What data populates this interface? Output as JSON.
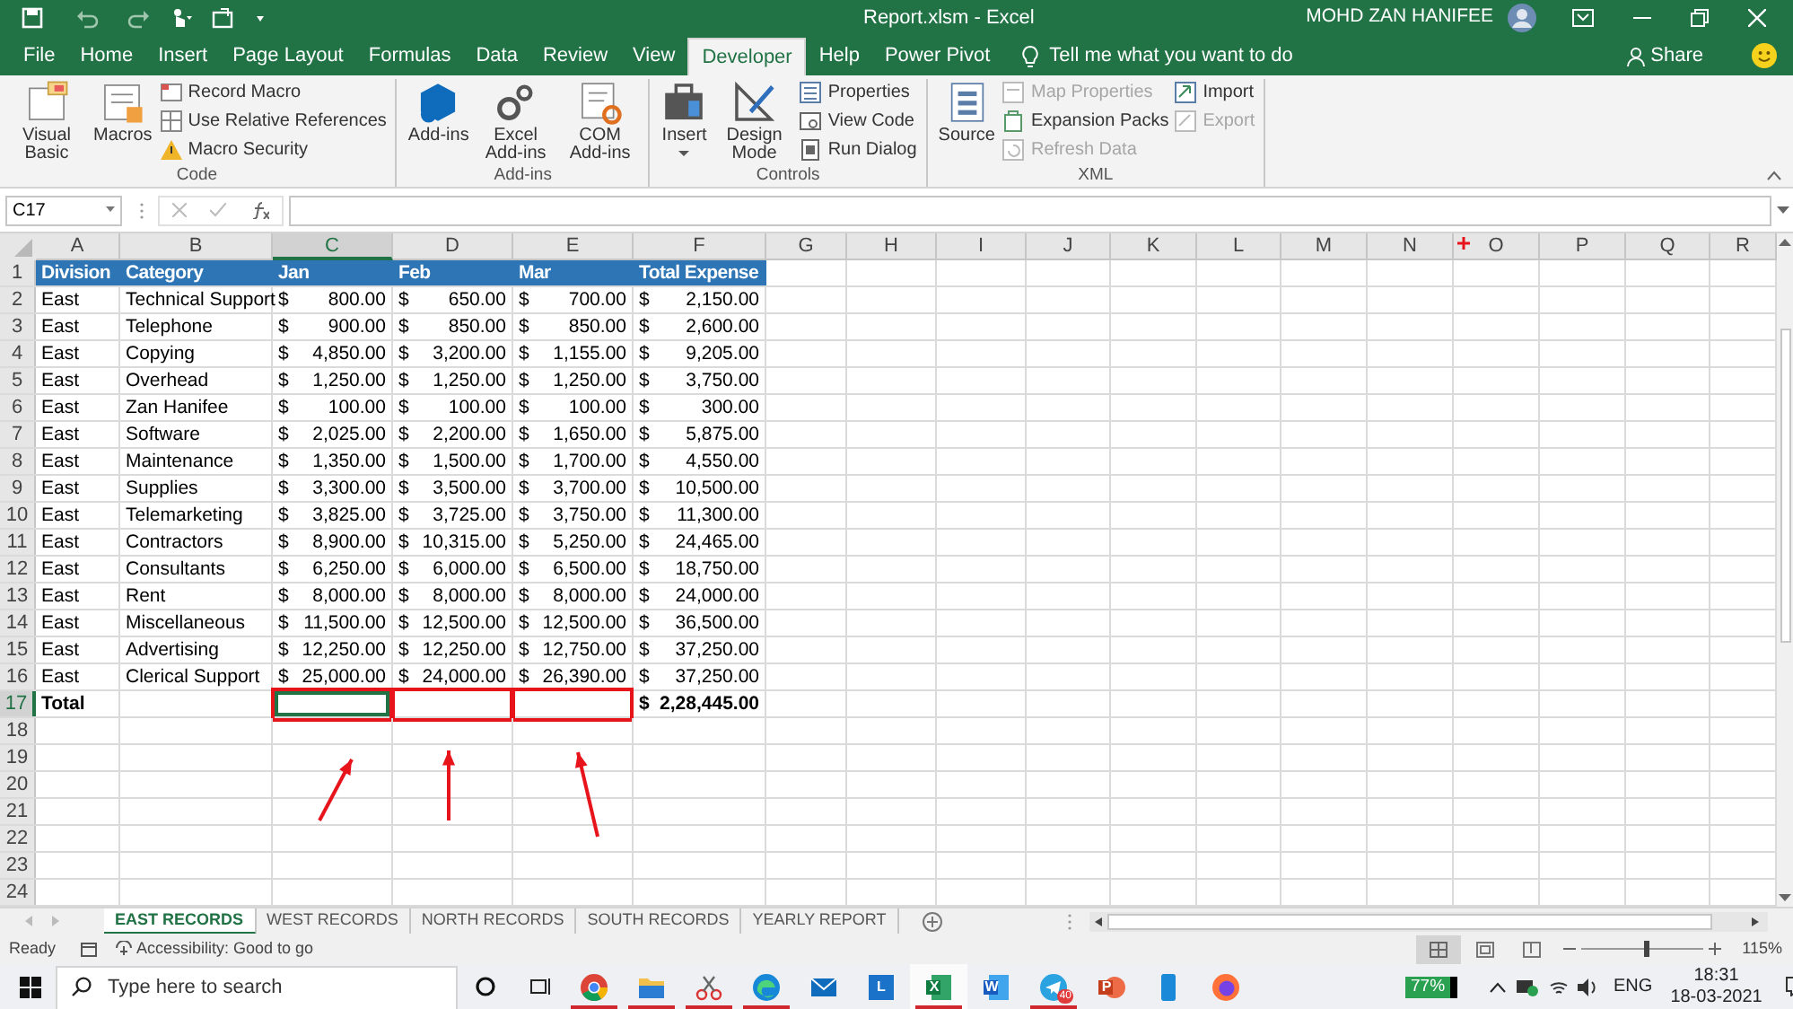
{
  "title_bar": {
    "file_title": "Report.xlsm  -  Excel",
    "user_name": "MOHD ZAN HANIFEE"
  },
  "ribbon_tabs": [
    {
      "label": "File",
      "selected": false
    },
    {
      "label": "Home",
      "selected": false
    },
    {
      "label": "Insert",
      "selected": false
    },
    {
      "label": "Page Layout",
      "selected": false
    },
    {
      "label": "Formulas",
      "selected": false
    },
    {
      "label": "Data",
      "selected": false
    },
    {
      "label": "Review",
      "selected": false
    },
    {
      "label": "View",
      "selected": false
    },
    {
      "label": "Developer",
      "selected": true
    },
    {
      "label": "Help",
      "selected": false
    },
    {
      "label": "Power Pivot",
      "selected": false
    }
  ],
  "tell_me": "Tell me what you want to do",
  "share": "Share",
  "ribbon_groups": [
    {
      "label": "Code",
      "items": [
        {
          "kind": "large",
          "label": "Visual Basic"
        },
        {
          "kind": "large",
          "label": "Macros"
        },
        {
          "kind": "small_column",
          "buttons": [
            {
              "label": "Record Macro",
              "disabled": false
            },
            {
              "label": "Use Relative References",
              "disabled": false
            },
            {
              "label": "Macro Security",
              "disabled": false
            }
          ]
        }
      ]
    },
    {
      "label": "Add-ins",
      "items": [
        {
          "kind": "large",
          "label": "Add-ins"
        },
        {
          "kind": "large",
          "label": "Excel Add-ins"
        },
        {
          "kind": "large",
          "label": "COM Add-ins"
        }
      ]
    },
    {
      "label": "Controls",
      "items": [
        {
          "kind": "large",
          "label": "Insert",
          "dropdown": true
        },
        {
          "kind": "large",
          "label": "Design Mode"
        },
        {
          "kind": "small_column",
          "buttons": [
            {
              "label": "Properties",
              "disabled": false
            },
            {
              "label": "View Code",
              "disabled": false
            },
            {
              "label": "Run Dialog",
              "disabled": false
            }
          ]
        }
      ]
    },
    {
      "label": "XML",
      "items": [
        {
          "kind": "large",
          "label": "Source"
        },
        {
          "kind": "small_column",
          "buttons": [
            {
              "label": "Map Properties",
              "disabled": true
            },
            {
              "label": "Expansion Packs",
              "disabled": false
            },
            {
              "label": "Refresh Data",
              "disabled": true
            }
          ]
        },
        {
          "kind": "small_column",
          "buttons": [
            {
              "label": "Import",
              "disabled": false
            },
            {
              "label": "Export",
              "disabled": true
            }
          ]
        }
      ]
    }
  ],
  "formula_bar": {
    "name_box": "C17"
  },
  "columns": [
    {
      "label": "A",
      "selected": false
    },
    {
      "label": "B",
      "selected": false
    },
    {
      "label": "C",
      "selected": true
    },
    {
      "label": "D",
      "selected": false
    },
    {
      "label": "E",
      "selected": false
    },
    {
      "label": "F",
      "selected": false
    },
    {
      "label": "G",
      "selected": false
    },
    {
      "label": "H",
      "selected": false
    },
    {
      "label": "I",
      "selected": false
    },
    {
      "label": "J",
      "selected": false
    },
    {
      "label": "K",
      "selected": false
    },
    {
      "label": "L",
      "selected": false
    },
    {
      "label": "M",
      "selected": false
    },
    {
      "label": "N",
      "selected": false
    },
    {
      "label": "O",
      "selected": false
    },
    {
      "label": "P",
      "selected": false
    },
    {
      "label": "Q",
      "selected": false
    },
    {
      "label": "R",
      "selected": false
    }
  ],
  "rows": [
    {
      "number": "1",
      "kind": "header",
      "selected": false,
      "cells": [
        "Division",
        "Category",
        "Jan",
        "Feb",
        "Mar",
        "Total Expense"
      ]
    },
    {
      "number": "2",
      "kind": "data",
      "selected": false,
      "cells": [
        "East",
        "Technical Support",
        {
          "currency": "$",
          "amount": "800.00"
        },
        {
          "currency": "$",
          "amount": "650.00"
        },
        {
          "currency": "$",
          "amount": "700.00"
        },
        {
          "currency": "$",
          "amount": "2,150.00"
        }
      ]
    },
    {
      "number": "3",
      "kind": "data",
      "selected": false,
      "cells": [
        "East",
        "Telephone",
        {
          "currency": "$",
          "amount": "900.00"
        },
        {
          "currency": "$",
          "amount": "850.00"
        },
        {
          "currency": "$",
          "amount": "850.00"
        },
        {
          "currency": "$",
          "amount": "2,600.00"
        }
      ]
    },
    {
      "number": "4",
      "kind": "data",
      "selected": false,
      "cells": [
        "East",
        "Copying",
        {
          "currency": "$",
          "amount": "4,850.00"
        },
        {
          "currency": "$",
          "amount": "3,200.00"
        },
        {
          "currency": "$",
          "amount": "1,155.00"
        },
        {
          "currency": "$",
          "amount": "9,205.00"
        }
      ]
    },
    {
      "number": "5",
      "kind": "data",
      "selected": false,
      "cells": [
        "East",
        "Overhead",
        {
          "currency": "$",
          "amount": "1,250.00"
        },
        {
          "currency": "$",
          "amount": "1,250.00"
        },
        {
          "currency": "$",
          "amount": "1,250.00"
        },
        {
          "currency": "$",
          "amount": "3,750.00"
        }
      ]
    },
    {
      "number": "6",
      "kind": "data",
      "selected": false,
      "cells": [
        "East",
        "Zan Hanifee",
        {
          "currency": "$",
          "amount": "100.00"
        },
        {
          "currency": "$",
          "amount": "100.00"
        },
        {
          "currency": "$",
          "amount": "100.00"
        },
        {
          "currency": "$",
          "amount": "300.00"
        }
      ]
    },
    {
      "number": "7",
      "kind": "data",
      "selected": false,
      "cells": [
        "East",
        "Software",
        {
          "currency": "$",
          "amount": "2,025.00"
        },
        {
          "currency": "$",
          "amount": "2,200.00"
        },
        {
          "currency": "$",
          "amount": "1,650.00"
        },
        {
          "currency": "$",
          "amount": "5,875.00"
        }
      ]
    },
    {
      "number": "8",
      "kind": "data",
      "selected": false,
      "cells": [
        "East",
        "Maintenance",
        {
          "currency": "$",
          "amount": "1,350.00"
        },
        {
          "currency": "$",
          "amount": "1,500.00"
        },
        {
          "currency": "$",
          "amount": "1,700.00"
        },
        {
          "currency": "$",
          "amount": "4,550.00"
        }
      ]
    },
    {
      "number": "9",
      "kind": "data",
      "selected": false,
      "cells": [
        "East",
        "Supplies",
        {
          "currency": "$",
          "amount": "3,300.00"
        },
        {
          "currency": "$",
          "amount": "3,500.00"
        },
        {
          "currency": "$",
          "amount": "3,700.00"
        },
        {
          "currency": "$",
          "amount": "10,500.00"
        }
      ]
    },
    {
      "number": "10",
      "kind": "data",
      "selected": false,
      "cells": [
        "East",
        "Telemarketing",
        {
          "currency": "$",
          "amount": "3,825.00"
        },
        {
          "currency": "$",
          "amount": "3,725.00"
        },
        {
          "currency": "$",
          "amount": "3,750.00"
        },
        {
          "currency": "$",
          "amount": "11,300.00"
        }
      ]
    },
    {
      "number": "11",
      "kind": "data",
      "selected": false,
      "cells": [
        "East",
        "Contractors",
        {
          "currency": "$",
          "amount": "8,900.00"
        },
        {
          "currency": "$",
          "amount": "10,315.00"
        },
        {
          "currency": "$",
          "amount": "5,250.00"
        },
        {
          "currency": "$",
          "amount": "24,465.00"
        }
      ]
    },
    {
      "number": "12",
      "kind": "data",
      "selected": false,
      "cells": [
        "East",
        "Consultants",
        {
          "currency": "$",
          "amount": "6,250.00"
        },
        {
          "currency": "$",
          "amount": "6,000.00"
        },
        {
          "currency": "$",
          "amount": "6,500.00"
        },
        {
          "currency": "$",
          "amount": "18,750.00"
        }
      ]
    },
    {
      "number": "13",
      "kind": "data",
      "selected": false,
      "cells": [
        "East",
        "Rent",
        {
          "currency": "$",
          "amount": "8,000.00"
        },
        {
          "currency": "$",
          "amount": "8,000.00"
        },
        {
          "currency": "$",
          "amount": "8,000.00"
        },
        {
          "currency": "$",
          "amount": "24,000.00"
        }
      ]
    },
    {
      "number": "14",
      "kind": "data",
      "selected": false,
      "cells": [
        "East",
        "Miscellaneous",
        {
          "currency": "$",
          "amount": "11,500.00"
        },
        {
          "currency": "$",
          "amount": "12,500.00"
        },
        {
          "currency": "$",
          "amount": "12,500.00"
        },
        {
          "currency": "$",
          "amount": "36,500.00"
        }
      ]
    },
    {
      "number": "15",
      "kind": "data",
      "selected": false,
      "cells": [
        "East",
        "Advertising",
        {
          "currency": "$",
          "amount": "12,250.00"
        },
        {
          "currency": "$",
          "amount": "12,250.00"
        },
        {
          "currency": "$",
          "amount": "12,750.00"
        },
        {
          "currency": "$",
          "amount": "37,250.00"
        }
      ]
    },
    {
      "number": "16",
      "kind": "data",
      "selected": false,
      "cells": [
        "East",
        "Clerical Support",
        {
          "currency": "$",
          "amount": "25,000.00"
        },
        {
          "currency": "$",
          "amount": "24,000.00"
        },
        {
          "currency": "$",
          "amount": "26,390.00"
        },
        {
          "currency": "$",
          "amount": "37,250.00"
        }
      ]
    },
    {
      "number": "17",
      "kind": "total",
      "selected": true,
      "cells": [
        "Total",
        null,
        {
          "annotated": true
        },
        {
          "annotated": true
        },
        {
          "annotated": true
        },
        {
          "currency": "$",
          "amount": "2,28,445.00"
        }
      ]
    },
    {
      "number": "18",
      "kind": "empty",
      "selected": false
    },
    {
      "number": "19",
      "kind": "empty",
      "selected": false
    },
    {
      "number": "20",
      "kind": "empty",
      "selected": false
    },
    {
      "number": "21",
      "kind": "empty",
      "selected": false
    },
    {
      "number": "22",
      "kind": "empty",
      "selected": false
    },
    {
      "number": "23",
      "kind": "empty",
      "selected": false
    },
    {
      "number": "24",
      "kind": "empty",
      "selected": false
    }
  ],
  "sheet_tabs": [
    {
      "label": "EAST RECORDS",
      "selected": true
    },
    {
      "label": "WEST RECORDS",
      "selected": false
    },
    {
      "label": "NORTH RECORDS",
      "selected": false
    },
    {
      "label": "SOUTH RECORDS",
      "selected": false
    },
    {
      "label": "YEARLY REPORT",
      "selected": false
    }
  ],
  "status_bar": {
    "mode": "Ready",
    "accessibility": "Accessibility: Good to go",
    "zoom_slider": {
      "level": 0.55
    },
    "zoom": "115%"
  },
  "taskbar": {
    "search_placeholder": "Type here to search",
    "apps": [
      {
        "kind": "chrome",
        "running": true,
        "selected": false
      },
      {
        "kind": "folder",
        "running": true,
        "selected": false
      },
      {
        "kind": "scissors",
        "running": true,
        "selected": false
      },
      {
        "kind": "edge",
        "running": true,
        "selected": false
      },
      {
        "kind": "mail",
        "running": false,
        "selected": false
      },
      {
        "kind": "letter",
        "glyph": "L",
        "running": false,
        "selected": false
      },
      {
        "kind": "excel",
        "glyph": "X",
        "running": true,
        "selected": true
      },
      {
        "kind": "word",
        "glyph": "W",
        "running": false,
        "selected": false
      },
      {
        "kind": "telegram",
        "badge": "40",
        "running": true,
        "selected": false
      },
      {
        "kind": "powerpoint",
        "glyph": "P",
        "running": false,
        "selected": false
      },
      {
        "kind": "phone",
        "running": false,
        "selected": false
      },
      {
        "kind": "firefox",
        "running": false,
        "selected": false
      }
    ],
    "battery": "77%",
    "language": "ENG",
    "time": "18:31",
    "date": "18-03-2021"
  }
}
